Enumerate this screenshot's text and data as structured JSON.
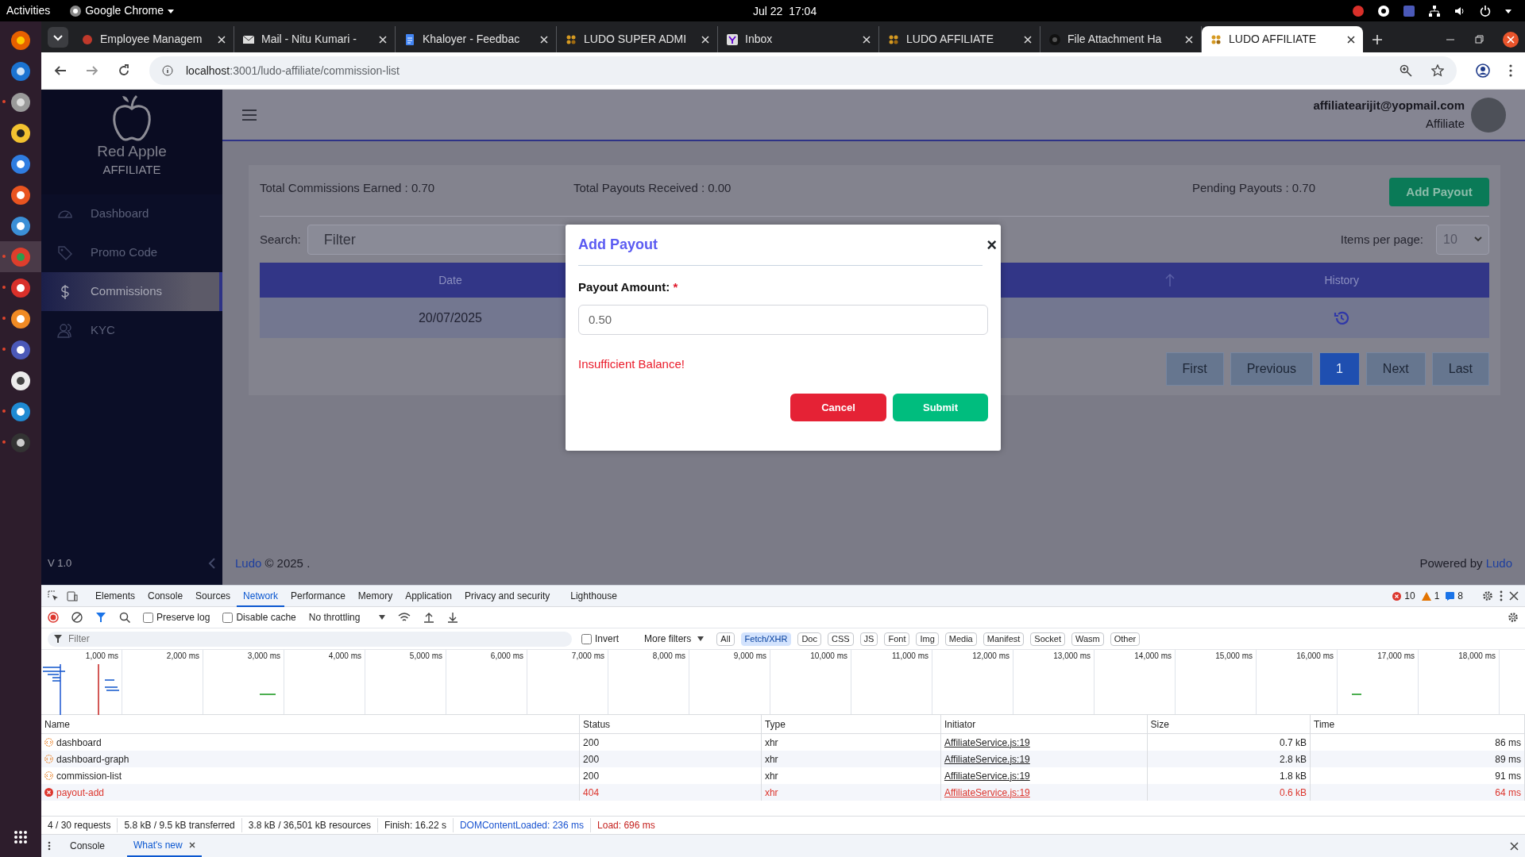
{
  "os_bar": {
    "activities": "Activities",
    "app": "Google Chrome",
    "clock": "Jul 22  17:04"
  },
  "dock": [
    {
      "kind": "fox",
      "running": false,
      "selected": false
    },
    {
      "kind": "bird",
      "running": false,
      "selected": false
    },
    {
      "kind": "folder",
      "running": true,
      "selected": false
    },
    {
      "kind": "speaker",
      "running": false,
      "selected": false
    },
    {
      "kind": "doc",
      "running": false,
      "selected": false
    },
    {
      "kind": "store",
      "running": false,
      "selected": false
    },
    {
      "kind": "help",
      "running": false,
      "selected": false
    },
    {
      "kind": "chrome",
      "running": true,
      "selected": true
    },
    {
      "kind": "apple",
      "running": true,
      "selected": false
    },
    {
      "kind": "brush",
      "running": true,
      "selected": false
    },
    {
      "kind": "team",
      "running": true,
      "selected": false
    },
    {
      "kind": "editor",
      "running": false,
      "selected": false
    },
    {
      "kind": "code",
      "running": true,
      "selected": false
    },
    {
      "kind": "terminal",
      "running": true,
      "selected": false
    }
  ],
  "browser": {
    "tabs": [
      {
        "title": "Employee Managem",
        "selected": false
      },
      {
        "title": "Mail - Nitu Kumari -",
        "selected": false
      },
      {
        "title": "Khaloyer - Feedbac",
        "selected": false
      },
      {
        "title": "LUDO SUPER ADMI",
        "selected": false
      },
      {
        "title": "Inbox",
        "selected": false
      },
      {
        "title": "LUDO AFFILIATE",
        "selected": false
      },
      {
        "title": "File Attachment Ha",
        "selected": false
      },
      {
        "title": "LUDO AFFILIATE",
        "selected": true
      }
    ],
    "url_host": "localhost",
    "url_path": ":3001/ludo-affiliate/commission-list"
  },
  "app": {
    "brand": "Red Apple",
    "brand_sub": "AFFILIATE",
    "menu": [
      {
        "label": "Dashboard",
        "selected": false
      },
      {
        "label": "Promo Code",
        "selected": false
      },
      {
        "label": "Commissions",
        "selected": true
      },
      {
        "label": "KYC",
        "selected": false
      }
    ],
    "version": "V 1.0",
    "user": {
      "email": "affiliatearijit@yopmail.com",
      "role": "Affiliate"
    },
    "stats": [
      "Total Commissions Earned : 0.70",
      "Total Payouts Received : 0.00",
      "Pending Payouts : 0.70"
    ],
    "add_button": "Add Payout",
    "search_label": "Search:",
    "search_placeholder": "Filter",
    "per_page_label": "Items per page:",
    "per_page_value": "10",
    "columns": [
      "Date",
      "History"
    ],
    "rows": [
      {
        "date": "20/07/2025"
      }
    ],
    "pages": [
      {
        "label": "First",
        "selected": false
      },
      {
        "label": "Previous",
        "selected": false
      },
      {
        "label": "1",
        "selected": true
      },
      {
        "label": "Next",
        "selected": false
      },
      {
        "label": "Last",
        "selected": false
      }
    ],
    "footer": {
      "link": "Ludo",
      "copyright": "© 2025 .",
      "powered": "Powered by",
      "powered_link": "Ludo"
    }
  },
  "modal": {
    "title": "Add Payout",
    "close": "×",
    "label": "Payout Amount:",
    "required": "*",
    "value": "0.50",
    "error": "Insufficient Balance!",
    "cancel": "Cancel",
    "submit": "Submit"
  },
  "devtools": {
    "tabs": [
      {
        "label": "Elements",
        "selected": false
      },
      {
        "label": "Console",
        "selected": false
      },
      {
        "label": "Sources",
        "selected": false
      },
      {
        "label": "Network",
        "selected": true
      },
      {
        "label": "Performance",
        "selected": false
      },
      {
        "label": "Memory",
        "selected": false
      },
      {
        "label": "Application",
        "selected": false
      },
      {
        "label": "Privacy and security",
        "selected": false
      },
      {
        "label": "Lighthouse",
        "selected": false
      }
    ],
    "errors": "10",
    "warnings": "1",
    "messages": "8",
    "preserve_log": {
      "label": "Preserve log",
      "checked": false
    },
    "disable_cache": {
      "label": "Disable cache",
      "checked": false
    },
    "throttling": "No throttling",
    "filter_placeholder": "Filter",
    "invert": {
      "label": "Invert",
      "checked": false
    },
    "more_filters": "More filters",
    "types": [
      {
        "label": "All",
        "selected": false
      },
      {
        "label": "Fetch/XHR",
        "selected": true
      },
      {
        "label": "Doc",
        "selected": false
      },
      {
        "label": "CSS",
        "selected": false
      },
      {
        "label": "JS",
        "selected": false
      },
      {
        "label": "Font",
        "selected": false
      },
      {
        "label": "Img",
        "selected": false
      },
      {
        "label": "Media",
        "selected": false
      },
      {
        "label": "Manifest",
        "selected": false
      },
      {
        "label": "Socket",
        "selected": false
      },
      {
        "label": "Wasm",
        "selected": false
      },
      {
        "label": "Other",
        "selected": false
      }
    ],
    "ticks": [
      "1,000 ms",
      "2,000 ms",
      "3,000 ms",
      "4,000 ms",
      "5,000 ms",
      "6,000 ms",
      "7,000 ms",
      "8,000 ms",
      "9,000 ms",
      "10,000 ms",
      "11,000 ms",
      "12,000 ms",
      "13,000 ms",
      "14,000 ms",
      "15,000 ms",
      "16,000 ms",
      "17,000 ms",
      "18,000 ms"
    ],
    "columns": [
      "Name",
      "Status",
      "Type",
      "Initiator",
      "Size",
      "Time"
    ],
    "requests": [
      {
        "name": "dashboard",
        "status": "200",
        "type": "xhr",
        "initiator": "AffiliateService.js:19",
        "size": "0.7 kB",
        "time": "86 ms",
        "failed": false
      },
      {
        "name": "dashboard-graph",
        "status": "200",
        "type": "xhr",
        "initiator": "AffiliateService.js:19",
        "size": "2.8 kB",
        "time": "89 ms",
        "failed": false
      },
      {
        "name": "commission-list",
        "status": "200",
        "type": "xhr",
        "initiator": "AffiliateService.js:19",
        "size": "1.8 kB",
        "time": "91 ms",
        "failed": false
      },
      {
        "name": "payout-add",
        "status": "404",
        "type": "xhr",
        "initiator": "AffiliateService.js:19",
        "size": "0.6 kB",
        "time": "64 ms",
        "failed": true
      }
    ],
    "summary": [
      {
        "text": "4 / 30 requests",
        "kind": "plain"
      },
      {
        "text": "5.8 kB / 9.5 kB transferred",
        "kind": "plain"
      },
      {
        "text": "3.8 kB / 36,501 kB resources",
        "kind": "plain"
      },
      {
        "text": "Finish: 16.22 s",
        "kind": "plain"
      },
      {
        "text": "DOMContentLoaded: 236 ms",
        "kind": "dom"
      },
      {
        "text": "Load: 696 ms",
        "kind": "load"
      }
    ],
    "drawer": [
      {
        "label": "Console",
        "selected": false,
        "closable": false
      },
      {
        "label": "What's new",
        "selected": true,
        "closable": true
      }
    ]
  }
}
